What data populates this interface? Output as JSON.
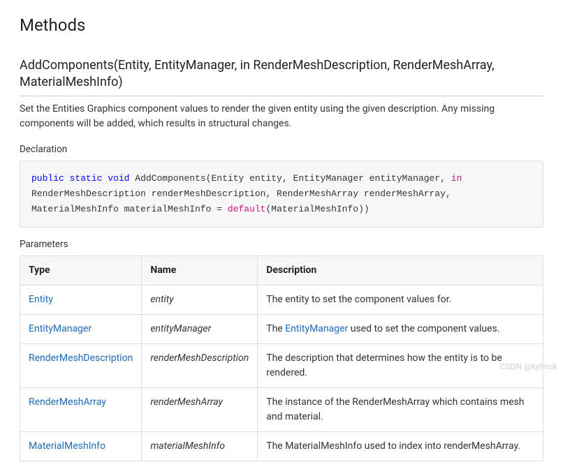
{
  "section": {
    "title": "Methods"
  },
  "method": {
    "title": "AddComponents(Entity, EntityManager, in RenderMeshDescription, RenderMeshArray, MaterialMeshInfo)",
    "description": "Set the Entities Graphics component values to render the given entity using the given description. Any missing components will be added, which results in structural changes.",
    "declaration_label": "Declaration",
    "code": {
      "kw_public": "public",
      "kw_static": "static",
      "kw_void": "void",
      "name": "AddComponents",
      "kw_in": "in",
      "kw_default": "default",
      "signature_tail": "(Entity entity, EntityManager entityManager, ",
      "signature_tail2": " RenderMeshDescription renderMeshDescription, RenderMeshArray renderMeshArray, MaterialMeshInfo materialMeshInfo = ",
      "signature_tail3": "(MaterialMeshInfo))"
    },
    "parameters_label": "Parameters",
    "table": {
      "headers": {
        "type": "Type",
        "name": "Name",
        "desc": "Description"
      },
      "rows": [
        {
          "type": "Entity",
          "name": "entity",
          "desc_pre": "The entity to set the component values for.",
          "link": "",
          "desc_post": ""
        },
        {
          "type": "EntityManager",
          "name": "entityManager",
          "desc_pre": "The ",
          "link": "EntityManager",
          "desc_post": " used to set the component values."
        },
        {
          "type": "RenderMeshDescription",
          "name": "renderMeshDescription",
          "desc_pre": "The description that determines how the entity is to be rendered.",
          "link": "",
          "desc_post": ""
        },
        {
          "type": "RenderMeshArray",
          "name": "renderMeshArray",
          "desc_pre": "The instance of the RenderMeshArray which contains mesh and material.",
          "link": "",
          "desc_post": ""
        },
        {
          "type": "MaterialMeshInfo",
          "name": "materialMeshInfo",
          "desc_pre": "The MaterialMeshInfo used to index into renderMeshArray.",
          "link": "",
          "desc_post": ""
        }
      ]
    }
  },
  "watermark": "CSDN @kylinok"
}
